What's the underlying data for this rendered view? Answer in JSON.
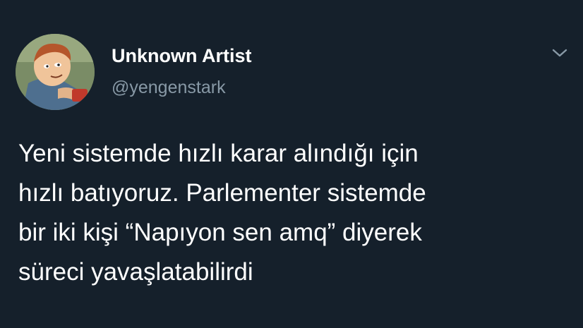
{
  "author": {
    "display_name": "Unknown Artist",
    "handle": "@yengenstark",
    "avatar_icon": "cartoon-character-avatar"
  },
  "menu": {
    "icon": "chevron-down-icon"
  },
  "tweet": {
    "lines": [
      "Yeni sistemde hızlı karar alındığı için",
      "hızlı batıyoruz. Parlementer sistemde",
      "bir iki kişi “Napıyon sen amq” diyerek",
      "süreci yavaşlatabilirdi"
    ]
  },
  "colors": {
    "background": "#15202b",
    "text_primary": "#ffffff",
    "text_secondary": "#8899a6"
  }
}
